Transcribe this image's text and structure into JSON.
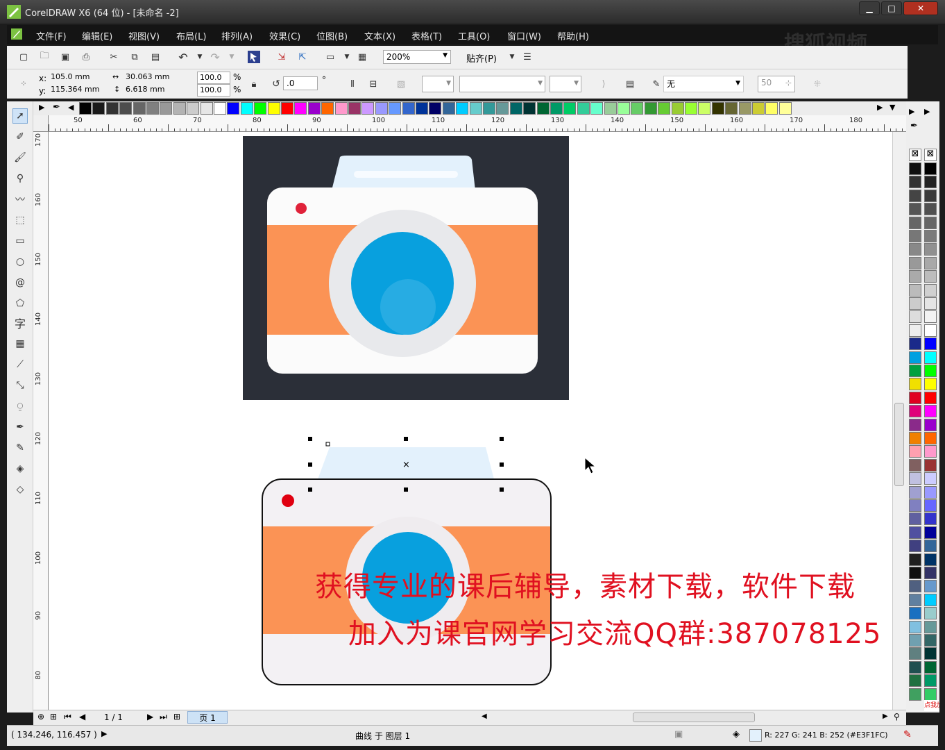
{
  "window": {
    "title": "CorelDRAW X6 (64 位) - [未命名 -2]",
    "min": "▁",
    "max": "□",
    "close": "✕"
  },
  "menu": [
    "文件(F)",
    "编辑(E)",
    "视图(V)",
    "布局(L)",
    "排列(A)",
    "效果(C)",
    "位图(B)",
    "文本(X)",
    "表格(T)",
    "工具(O)",
    "窗口(W)",
    "帮助(H)"
  ],
  "toolbar": {
    "zoom": "200%",
    "snap": "贴齐(P)"
  },
  "propbar": {
    "x_label": "x:",
    "x_value": "105.0 mm",
    "y_label": "y:",
    "y_value": "115.364 mm",
    "w_value": "30.063 mm",
    "h_value": "6.618 mm",
    "sx": "100.0",
    "sy": "100.0",
    "pct": "%",
    "rotation": ".0",
    "degree": "°",
    "outline": "无",
    "num50": "50"
  },
  "ruler": {
    "h": [
      "50",
      "60",
      "70",
      "80",
      "90",
      "100",
      "110",
      "120",
      "130",
      "140",
      "150",
      "160",
      "170",
      "180"
    ],
    "v": [
      "170",
      "160",
      "150",
      "140",
      "130",
      "120",
      "110",
      "100",
      "90",
      "80"
    ]
  },
  "pagebar": {
    "count": "1 / 1",
    "tab": "页 1"
  },
  "status": {
    "coords": "( 134.246, 116.457 )",
    "object": "曲线 于 图层 1",
    "color": "R: 227 G: 241 B: 252 (#E3F1FC)"
  },
  "watermark": {
    "line1": "获得专业的课后辅导，素材下载，软件下载",
    "line2": "加入为课官网学习交流QQ群:387078125",
    "corner": "搜狐视频",
    "badge": "点我加"
  },
  "colors": {
    "camera_bg": "#2b2f38",
    "camera_body": "#fbfbfb",
    "band": "#fb9355",
    "lens": "#08a0de",
    "red_dot": "#e0223a",
    "top_plate": "#e3f1fc"
  },
  "icons": {
    "undo": "undo-icon",
    "redo": "redo-icon",
    "cut": "scissors-icon"
  }
}
